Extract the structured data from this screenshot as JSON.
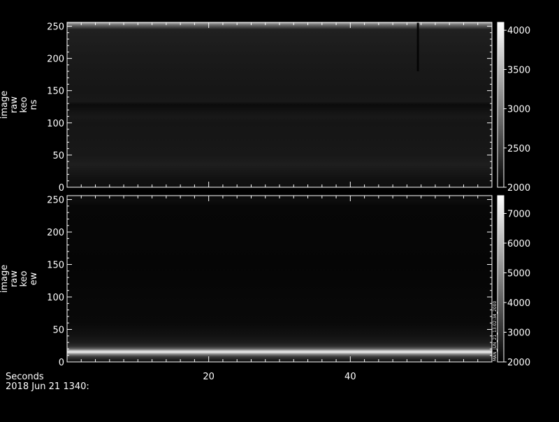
{
  "chart_data": [
    {
      "type": "heatmap",
      "ylabel_lines": [
        "image",
        "raw",
        "keo",
        "ns"
      ],
      "y_ticks": [
        0,
        50,
        100,
        150,
        200,
        250
      ],
      "ylim": [
        0,
        256
      ],
      "xlim": [
        0,
        60
      ],
      "colorbar": {
        "ticks": [
          2000,
          2500,
          3000,
          3500,
          4000
        ],
        "range": [
          2000,
          4100
        ]
      },
      "intensity_profile": [
        {
          "y": 0,
          "v": 2120
        },
        {
          "y": 10,
          "v": 2130
        },
        {
          "y": 35,
          "v": 2250
        },
        {
          "y": 50,
          "v": 2200
        },
        {
          "y": 100,
          "v": 2170
        },
        {
          "y": 108,
          "v": 2200
        },
        {
          "y": 112,
          "v": 2190
        },
        {
          "y": 128,
          "v": 2090
        },
        {
          "y": 133,
          "v": 2200
        },
        {
          "y": 150,
          "v": 2180
        },
        {
          "y": 200,
          "v": 2210
        },
        {
          "y": 245,
          "v": 2260
        },
        {
          "y": 252,
          "v": 2900
        },
        {
          "y": 256,
          "v": 3500
        }
      ],
      "artifacts": [
        {
          "x": 49.5,
          "y_from": 180,
          "y_to": 256
        }
      ]
    },
    {
      "type": "heatmap",
      "ylabel_lines": [
        "image",
        "raw",
        "keo",
        "ew"
      ],
      "y_ticks": [
        0,
        50,
        100,
        150,
        200,
        250
      ],
      "ylim": [
        0,
        256
      ],
      "xlim": [
        0,
        60
      ],
      "colorbar": {
        "ticks": [
          2000,
          3000,
          4000,
          5000,
          6000,
          7000
        ],
        "range": [
          2000,
          7600
        ]
      },
      "intensity_profile": [
        {
          "y": 0,
          "v": 2300
        },
        {
          "y": 4,
          "v": 2700
        },
        {
          "y": 8,
          "v": 3300
        },
        {
          "y": 11,
          "v": 4500
        },
        {
          "y": 13,
          "v": 5800
        },
        {
          "y": 15,
          "v": 7200
        },
        {
          "y": 17,
          "v": 6500
        },
        {
          "y": 20,
          "v": 4200
        },
        {
          "y": 24,
          "v": 3000
        },
        {
          "y": 30,
          "v": 2600
        },
        {
          "y": 40,
          "v": 2400
        },
        {
          "y": 60,
          "v": 2200
        },
        {
          "y": 150,
          "v": 2120
        },
        {
          "y": 240,
          "v": 2150
        },
        {
          "y": 248,
          "v": 2280
        },
        {
          "y": 256,
          "v": 2250
        }
      ],
      "side_label": "MAN_JUN_21_13:02:34_2000"
    }
  ],
  "x_axis": {
    "label": "Seconds",
    "ticks": [
      20,
      40
    ],
    "date_label": "2018 Jun 21 1340:"
  }
}
